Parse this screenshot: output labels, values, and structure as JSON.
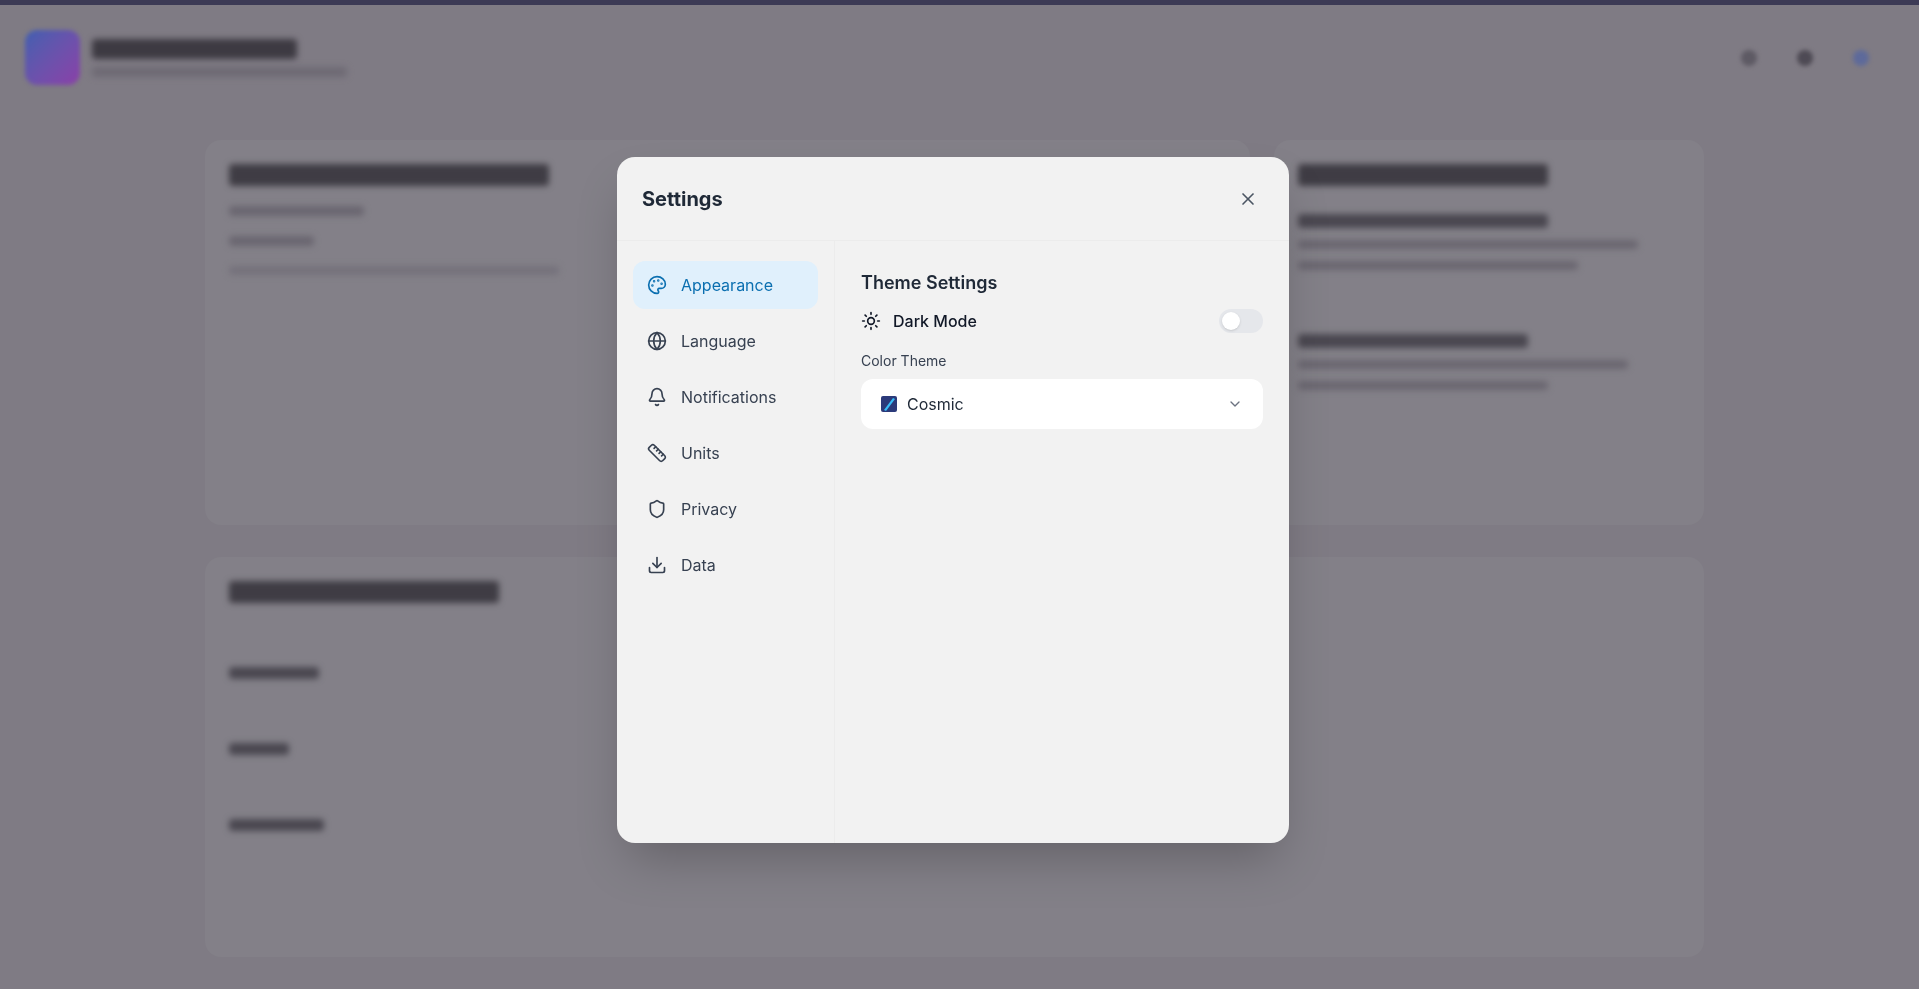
{
  "dialog": {
    "title": "Settings",
    "nav": [
      {
        "label": "Appearance",
        "kind": "palette",
        "selected": true
      },
      {
        "label": "Language",
        "kind": "globe",
        "selected": false
      },
      {
        "label": "Notifications",
        "kind": "bell",
        "selected": false
      },
      {
        "label": "Units",
        "kind": "ruler",
        "selected": false
      },
      {
        "label": "Privacy",
        "kind": "shield",
        "selected": false
      },
      {
        "label": "Data",
        "kind": "download",
        "selected": false
      }
    ],
    "section_title": "Theme Settings",
    "dark_mode": {
      "label": "Dark Mode",
      "on": false
    },
    "color_theme": {
      "label": "Color Theme",
      "value": "Cosmic"
    }
  }
}
